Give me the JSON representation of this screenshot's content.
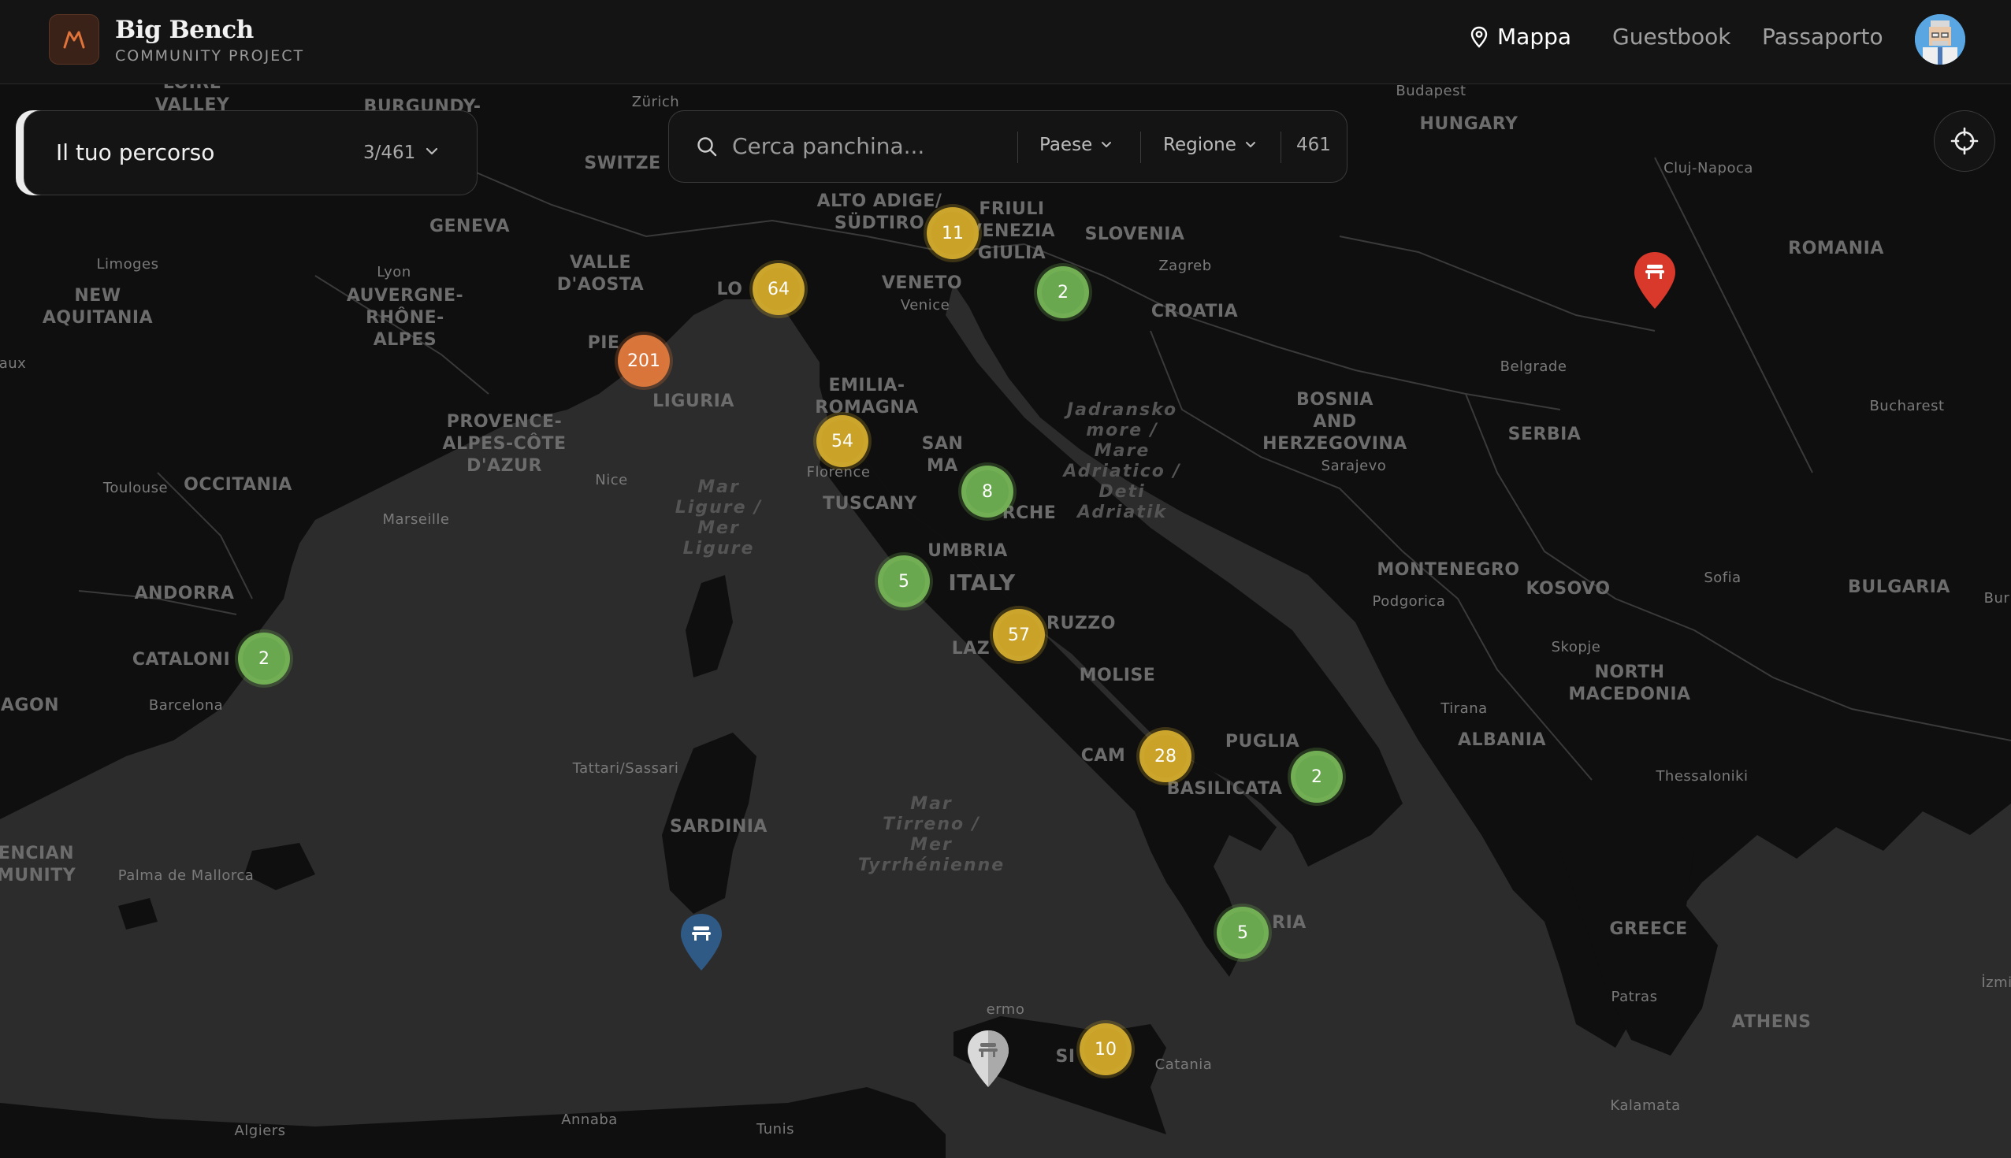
{
  "header": {
    "brand_title": "Big Bench",
    "brand_subtitle": "COMMUNITY PROJECT",
    "nav": [
      {
        "label": "Mappa",
        "active": true
      },
      {
        "label": "Guestbook",
        "active": false
      },
      {
        "label": "Passaporto",
        "active": false
      }
    ]
  },
  "route_panel": {
    "label": "Il tuo percorso",
    "count": "3/461"
  },
  "search": {
    "placeholder": "Cerca panchina...",
    "filter_country": "Paese",
    "filter_region": "Regione",
    "total": "461"
  },
  "colors": {
    "accent": "#d9743a",
    "cluster_green": "#6aa84f",
    "cluster_yellow": "#c9a227",
    "cluster_orange": "#d9743a",
    "pin_red": "#d8392b",
    "pin_blue": "#2f5a86",
    "pin_white": "#d9d9d9"
  },
  "map": {
    "places": {
      "hungary": "HUNGARY",
      "romania": "ROMANIA",
      "slovenia": "SLOVENIA",
      "croatia": "CROATIA",
      "bosnia": "BOSNIA\nAND\nHERZEGOVINA",
      "serbia": "SERBIA",
      "montenegro": "MONTENEGRO",
      "kosovo": "KOSOVO",
      "bulgaria": "BULGARIA",
      "north_macedonia": "NORTH\nMACEDONIA",
      "albania": "ALBANIA",
      "greece": "GREECE",
      "italy": "ITALY",
      "switzerland": "SWITZE",
      "alto_adige": "ALTO ADIGE/\nSÜDTIRO",
      "friuli": "FRIULI\nVENEZIA\nGIULIA",
      "veneto": "VENETO",
      "valle": "VALLE\nD'AOSTA",
      "piemonte": "PIE",
      "lombardia": "LO",
      "liguria": "LIGURIA",
      "emilia": "EMILIA-\nROMAGNA",
      "san_marino": "SAN\nMA",
      "marche": "RCHE",
      "tuscany": "TUSCANY",
      "umbria": "UMBRIA",
      "lazio": "LAZ",
      "abruzzo": "RUZZO",
      "molise": "MOLISE",
      "campania": "CAM",
      "puglia": "PUGLIA",
      "basilicata": "BASILICATA",
      "calabria": "RIA",
      "sicilia": "SI",
      "sardinia": "SARDINIA",
      "new_aquitania": "NEW\nAQUITANIA",
      "auvergne": "AUVERGNE-\nRHÔNE-\nALPES",
      "provence": "PROVENCE-\nALPES-CÔTE\nD'AZUR",
      "occitania": "OCCITANIA",
      "andorra": "ANDORRA",
      "catalonia": "CATALONI",
      "aragon": "AGON",
      "valencian": "ENCIAN\nMUNITY",
      "geneva": "GENEVA",
      "burgundy": "BURGUNDY-",
      "loire": "LOIRE\nVALLEY",
      "adriatic_sea": "Jadransko\nmore /\nMare\nAdriatico /\nDeti\nAdriatik",
      "ligurian_sea": "Mar\nLigure /\nMer\nLigure",
      "tyrrhenian_sea": "Mar\nTirreno /\nMer\nTyrrhénienne"
    },
    "cities": {
      "budapest": "Budapest",
      "zurich": "Zürich",
      "cluj": "Cluj-Napoca",
      "zagreb": "Zagreb",
      "belgrade": "Belgrade",
      "bucharest": "Bucharest",
      "sarajevo": "Sarajevo",
      "podgorica": "Podgorica",
      "sofia": "Sofia",
      "skopje": "Skopje",
      "tirana": "Tirana",
      "thessaloniki": "Thessaloniki",
      "athens": "ATHENS",
      "patras": "Patras",
      "kalamata": "Kalamata",
      "izmir": "İzmi",
      "limoges": "Limoges",
      "lyon": "Lyon",
      "toulouse": "Toulouse",
      "marseille": "Marseille",
      "nice": "Nice",
      "barcelona": "Barcelona",
      "palma": "Palma de Mallorca",
      "algiers": "Algiers",
      "annaba": "Annaba",
      "tunis": "Tunis",
      "tattari": "Tattari/Sassari",
      "catania": "Catania",
      "venice": "Venice",
      "florence": "Florence",
      "palermo": "ermo",
      "bur": "Bur",
      "aux": "aux"
    },
    "clusters": [
      {
        "count": "11",
        "color": "yellow"
      },
      {
        "count": "64",
        "color": "yellow"
      },
      {
        "count": "2",
        "color": "green"
      },
      {
        "count": "201",
        "color": "orange"
      },
      {
        "count": "54",
        "color": "yellow"
      },
      {
        "count": "8",
        "color": "green"
      },
      {
        "count": "5",
        "color": "green"
      },
      {
        "count": "57",
        "color": "yellow"
      },
      {
        "count": "2",
        "color": "green"
      },
      {
        "count": "28",
        "color": "yellow"
      },
      {
        "count": "2",
        "color": "green"
      },
      {
        "count": "5",
        "color": "green"
      },
      {
        "count": "10",
        "color": "yellow"
      }
    ]
  }
}
